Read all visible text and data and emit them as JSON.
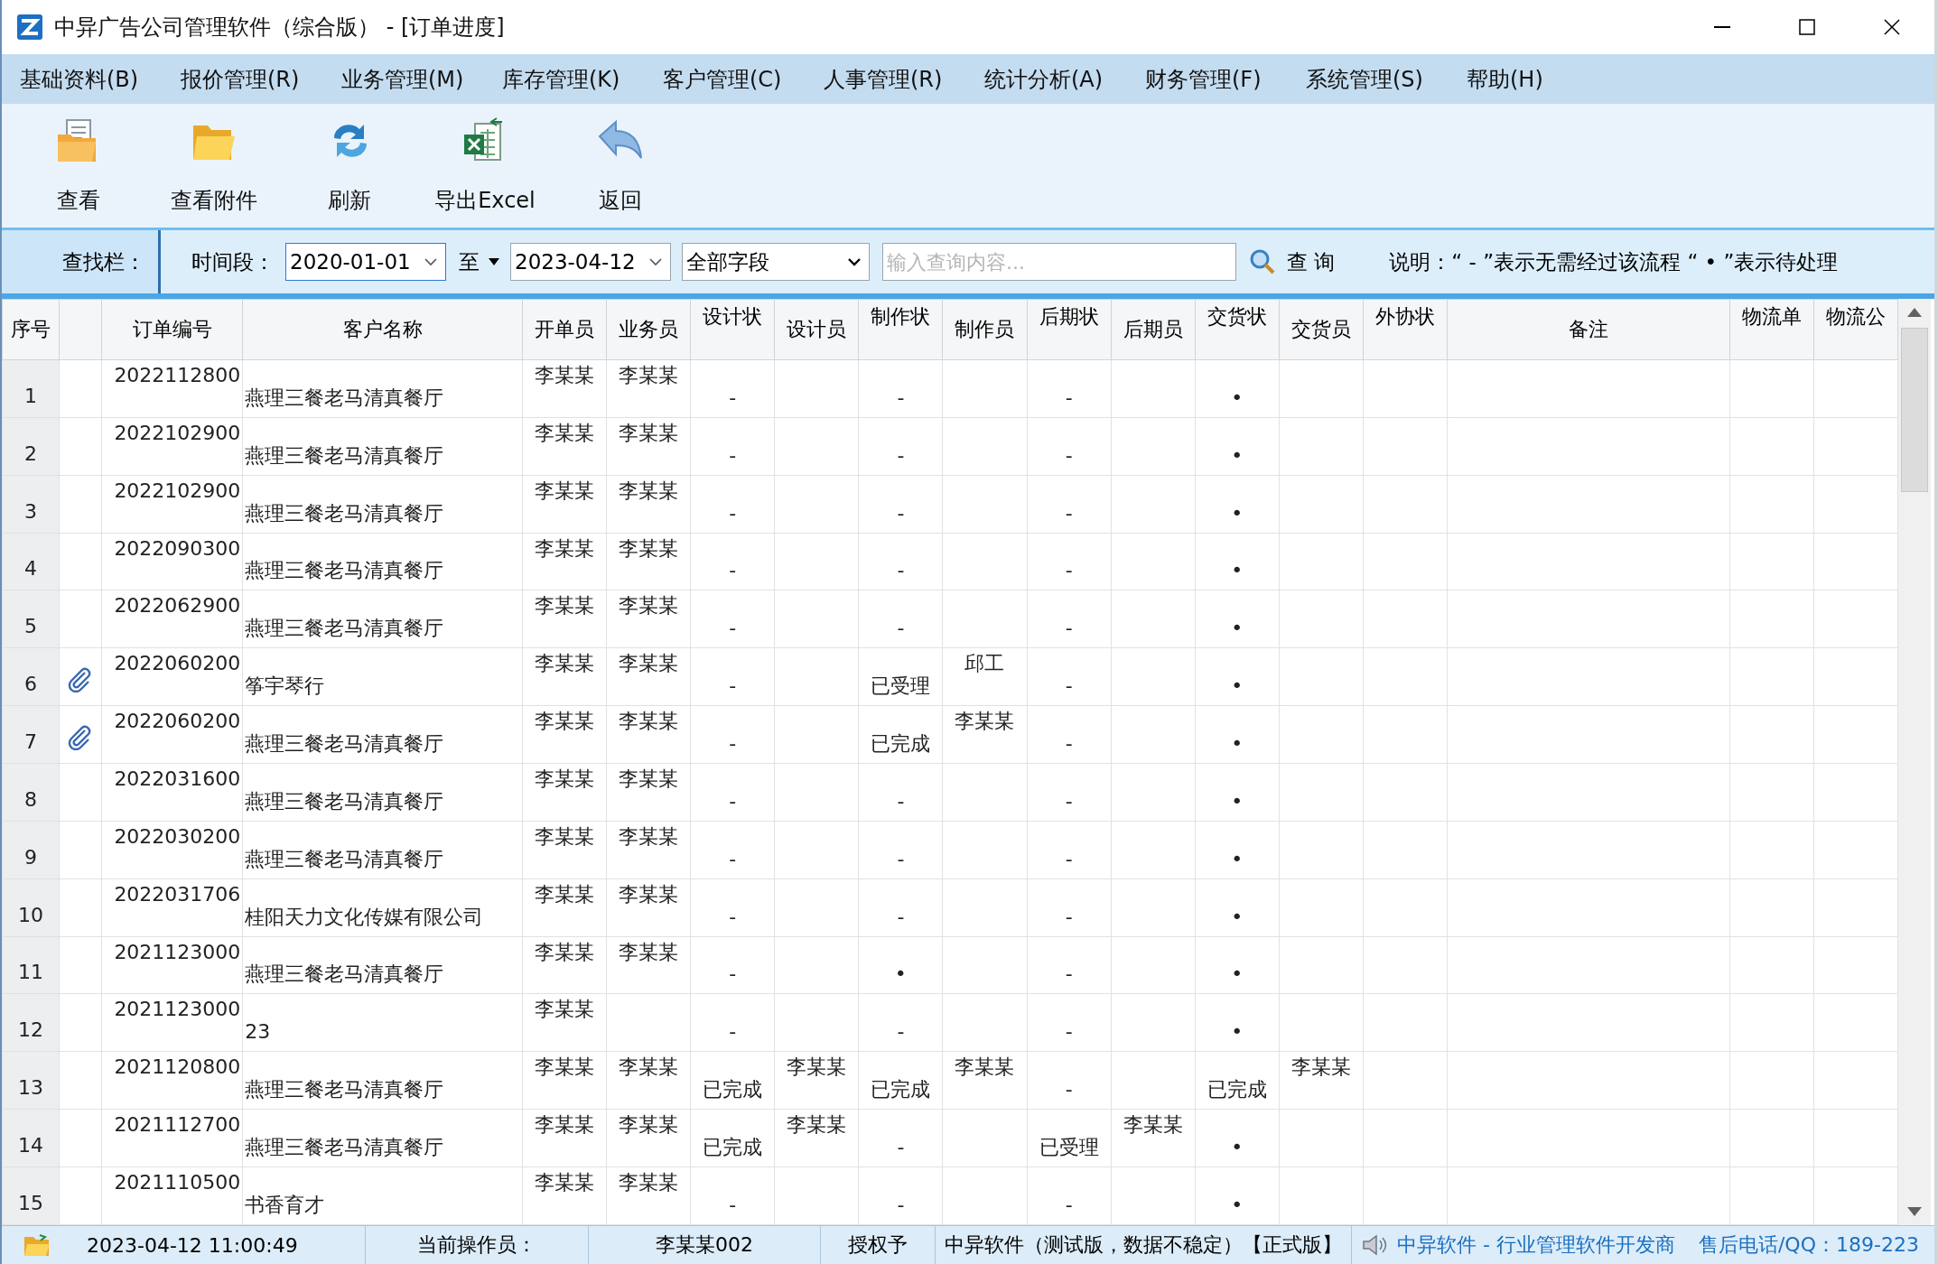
{
  "window": {
    "title": "中异广告公司管理软件（综合版） - [订单进度]"
  },
  "menu": [
    "基础资料(B)",
    "报价管理(R)",
    "业务管理(M)",
    "库存管理(K)",
    "客户管理(C)",
    "人事管理(R)",
    "统计分析(A)",
    "财务管理(F)",
    "系统管理(S)",
    "帮助(H)"
  ],
  "toolbar": [
    {
      "label": "查看",
      "kind": "view"
    },
    {
      "label": "查看附件",
      "kind": "folder"
    },
    {
      "label": "刷新",
      "kind": "refresh"
    },
    {
      "label": "导出Excel",
      "kind": "excel"
    },
    {
      "label": "返回",
      "kind": "back"
    }
  ],
  "search_bar": {
    "label": "查找栏：",
    "period_label": "时间段：",
    "date_from": "2020-01-01",
    "range_word": "至",
    "date_to": "2023-04-12",
    "field_select": "全部字段",
    "query": {
      "placeholder": "输入查询内容..."
    },
    "search_button": "查 询",
    "note": "说明：“ - ”表示无需经过该流程 “ • ”表示待处理"
  },
  "table": {
    "columns": [
      "序号",
      "订单编号",
      "客户名称",
      "开单员",
      "业务员",
      "设计状",
      "设计员",
      "制作状",
      "制作员",
      "后期状",
      "后期员",
      "交货状",
      "交货员",
      "外协状",
      "备注",
      "物流单",
      "物流公"
    ],
    "rows": [
      {
        "no": "1",
        "attachment": false,
        "order_no": "2022112800",
        "customer": "燕理三餐老马清真餐厅",
        "opener": "李某某",
        "salesman": "李某某",
        "design_status": "-",
        "production_status": "-",
        "post_status": "-",
        "delivery_status": "•"
      },
      {
        "no": "2",
        "attachment": false,
        "order_no": "2022102900",
        "customer": "燕理三餐老马清真餐厅",
        "opener": "李某某",
        "salesman": "李某某",
        "design_status": "-",
        "production_status": "-",
        "post_status": "-",
        "delivery_status": "•"
      },
      {
        "no": "3",
        "attachment": false,
        "order_no": "2022102900",
        "customer": "燕理三餐老马清真餐厅",
        "opener": "李某某",
        "salesman": "李某某",
        "design_status": "-",
        "production_status": "-",
        "post_status": "-",
        "delivery_status": "•"
      },
      {
        "no": "4",
        "attachment": false,
        "order_no": "2022090300",
        "customer": "燕理三餐老马清真餐厅",
        "opener": "李某某",
        "salesman": "李某某",
        "design_status": "-",
        "production_status": "-",
        "post_status": "-",
        "delivery_status": "•"
      },
      {
        "no": "5",
        "attachment": false,
        "order_no": "2022062900",
        "customer": "燕理三餐老马清真餐厅",
        "opener": "李某某",
        "salesman": "李某某",
        "design_status": "-",
        "production_status": "-",
        "post_status": "-",
        "delivery_status": "•"
      },
      {
        "no": "6",
        "attachment": true,
        "order_no": "2022060200",
        "customer": "筝宇琴行",
        "opener": "李某某",
        "salesman": "李某某",
        "design_status": "-",
        "production_status": "已受理",
        "producer": "邱工",
        "post_status": "-",
        "delivery_status": "•"
      },
      {
        "no": "7",
        "attachment": true,
        "order_no": "2022060200",
        "customer": "燕理三餐老马清真餐厅",
        "opener": "李某某",
        "salesman": "李某某",
        "design_status": "-",
        "production_status": "已完成",
        "producer": "李某某",
        "post_status": "-",
        "delivery_status": "•"
      },
      {
        "no": "8",
        "attachment": false,
        "order_no": "2022031600",
        "customer": "燕理三餐老马清真餐厅",
        "opener": "李某某",
        "salesman": "李某某",
        "design_status": "-",
        "production_status": "-",
        "post_status": "-",
        "delivery_status": "•"
      },
      {
        "no": "9",
        "attachment": false,
        "order_no": "2022030200",
        "customer": "燕理三餐老马清真餐厅",
        "opener": "李某某",
        "salesman": "李某某",
        "design_status": "-",
        "production_status": "-",
        "post_status": "-",
        "delivery_status": "•"
      },
      {
        "no": "10",
        "attachment": false,
        "order_no": "2022031706",
        "customer": "桂阳天力文化传媒有限公司",
        "opener": "李某某",
        "salesman": "李某某",
        "design_status": "-",
        "production_status": "-",
        "post_status": "-",
        "delivery_status": "•"
      },
      {
        "no": "11",
        "attachment": false,
        "order_no": "2021123000",
        "customer": "燕理三餐老马清真餐厅",
        "opener": "李某某",
        "salesman": "李某某",
        "design_status": "-",
        "production_status": "•",
        "post_status": "-",
        "delivery_status": "•"
      },
      {
        "no": "12",
        "attachment": false,
        "order_no": "2021123000",
        "customer": "23",
        "opener": "李某某",
        "design_status": "-",
        "production_status": "-",
        "post_status": "-",
        "delivery_status": "•"
      },
      {
        "no": "13",
        "attachment": false,
        "order_no": "2021120800",
        "customer": "燕理三餐老马清真餐厅",
        "opener": "李某某",
        "salesman": "李某某",
        "design_status": "已完成",
        "designer": "李某某",
        "production_status": "已完成",
        "producer": "李某某",
        "post_status": "-",
        "delivery_status": "已完成",
        "delivery_staff": "李某某"
      },
      {
        "no": "14",
        "attachment": false,
        "order_no": "2021112700",
        "customer": "燕理三餐老马清真餐厅",
        "opener": "李某某",
        "salesman": "李某某",
        "design_status": "已完成",
        "designer": "李某某",
        "production_status": "-",
        "post_status": "已受理",
        "post_staff": "李某某",
        "delivery_status": "•"
      },
      {
        "no": "15",
        "attachment": false,
        "order_no": "2021110500",
        "customer": "书香育才",
        "opener": "李某某",
        "salesman": "李某某",
        "design_status": "-",
        "production_status": "-",
        "post_status": "-",
        "delivery_status": "•"
      }
    ]
  },
  "status_bar": {
    "datetime": "2023-04-12 11:00:49",
    "operator_label": "当前操作员：",
    "operator": "李某某002",
    "license_label": "授权予",
    "licensee": "中异软件（测试版，数据不稳定）【正式版】",
    "vendor_link": "中异软件 - 行业管理软件开发商",
    "hotline": "售后电话/QQ：189-223"
  }
}
